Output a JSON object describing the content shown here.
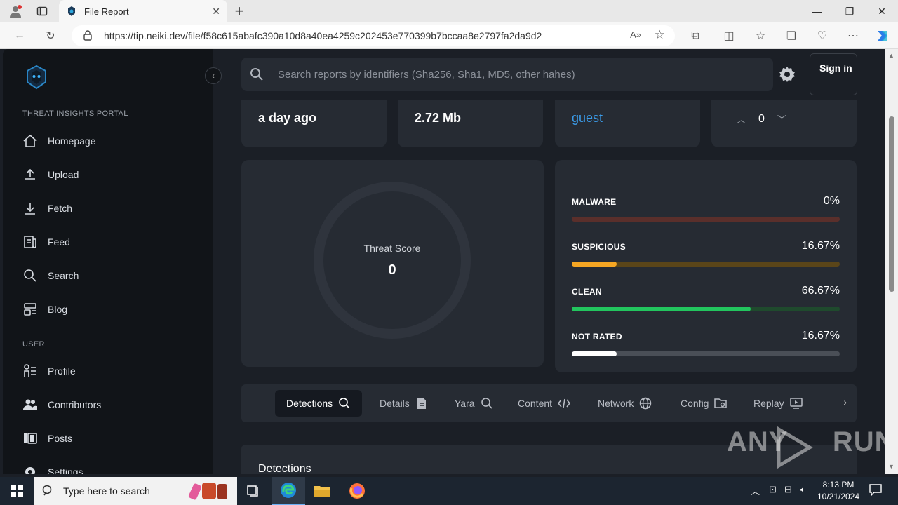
{
  "browser": {
    "tab_title": "File Report",
    "url": "https://tip.neiki.dev/file/f58c615abafc390a10d8a40ea4259c202453e770399b7bccaa8e2797fa2da9d2"
  },
  "sidebar": {
    "section_portal": "THREAT INSIGHTS PORTAL",
    "nav": [
      {
        "label": "Homepage"
      },
      {
        "label": "Upload"
      },
      {
        "label": "Fetch"
      },
      {
        "label": "Feed"
      },
      {
        "label": "Search"
      },
      {
        "label": "Blog"
      }
    ],
    "section_user": "USER",
    "user_nav": [
      {
        "label": "Profile"
      },
      {
        "label": "Contributors"
      },
      {
        "label": "Posts"
      },
      {
        "label": "Settings"
      }
    ]
  },
  "header": {
    "search_placeholder": "Search reports by identifiers (Sha256, Sha1, MD5, other hahes)",
    "signin_label": "Sign in"
  },
  "info": {
    "age": "a day ago",
    "size": "2.72 Mb",
    "uploader": "guest",
    "votes": "0"
  },
  "threat": {
    "label": "Threat Score",
    "value": "0"
  },
  "stats": [
    {
      "name": "MALWARE",
      "pct": "0%",
      "fraction": 0.0,
      "color": "#e0533f",
      "track": "#5a2f2b"
    },
    {
      "name": "SUSPICIOUS",
      "pct": "16.67%",
      "fraction": 0.1667,
      "color": "#f5a623",
      "track": "#5a4519"
    },
    {
      "name": "CLEAN",
      "pct": "66.67%",
      "fraction": 0.6667,
      "color": "#22c55e",
      "track": "#1f4a2d"
    },
    {
      "name": "NOT RATED",
      "pct": "16.67%",
      "fraction": 0.1667,
      "color": "#ffffff",
      "track": "#4a4f57"
    }
  ],
  "report_tabs": [
    {
      "label": "Detections"
    },
    {
      "label": "Details"
    },
    {
      "label": "Yara"
    },
    {
      "label": "Content"
    },
    {
      "label": "Network"
    },
    {
      "label": "Config"
    },
    {
      "label": "Replay"
    }
  ],
  "detections_title": "Detections",
  "watermark": "ANY RUN",
  "taskbar": {
    "search_placeholder": "Type here to search",
    "time": "8:13 PM",
    "date": "10/21/2024"
  }
}
